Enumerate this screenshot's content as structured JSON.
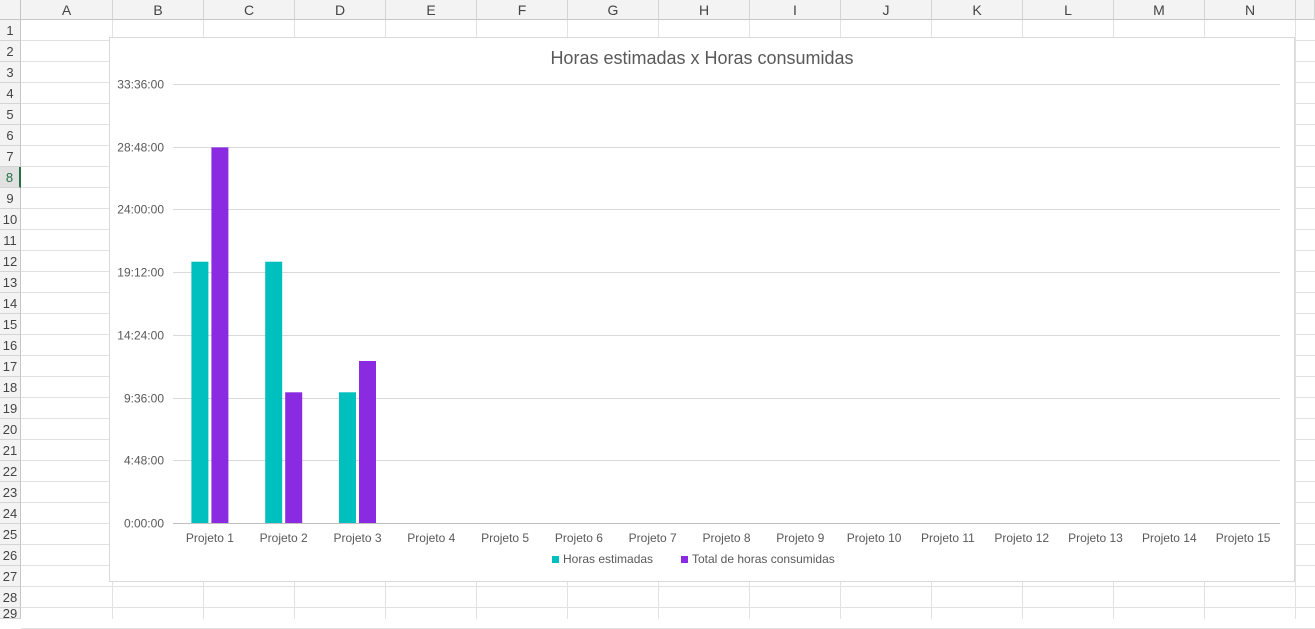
{
  "sheet": {
    "columns": [
      "A",
      "B",
      "C",
      "D",
      "E",
      "F",
      "G",
      "H",
      "I",
      "J",
      "K",
      "L",
      "M",
      "N"
    ],
    "rows": [
      "1",
      "2",
      "3",
      "4",
      "5",
      "6",
      "7",
      "8",
      "9",
      "10",
      "11",
      "12",
      "13",
      "14",
      "15",
      "16",
      "17",
      "18",
      "19",
      "20",
      "21",
      "22",
      "23",
      "24",
      "25",
      "26",
      "27",
      "28",
      "29"
    ],
    "active_row": "8",
    "header_accent": "#217346"
  },
  "chart_data": {
    "type": "bar",
    "title": "Horas estimadas x Horas consumidas",
    "categories": [
      "Projeto 1",
      "Projeto 2",
      "Projeto 3",
      "Projeto 4",
      "Projeto 5",
      "Projeto 6",
      "Projeto 7",
      "Projeto 8",
      "Projeto 9",
      "Projeto 10",
      "Projeto 11",
      "Projeto 12",
      "Projeto 13",
      "Projeto 14",
      "Projeto 15"
    ],
    "series": [
      {
        "name": "Horas estimadas",
        "color": "#00bfbf",
        "values": [
          20,
          20,
          10,
          null,
          null,
          null,
          null,
          null,
          null,
          null,
          null,
          null,
          null,
          null,
          null
        ]
      },
      {
        "name": "Total de horas consumidas",
        "color": "#8a2be2",
        "values": [
          28.75,
          10,
          12.4,
          null,
          null,
          null,
          null,
          null,
          null,
          null,
          null,
          null,
          null,
          null,
          null
        ]
      }
    ],
    "ylim": [
      0,
      33.6
    ],
    "y_ticks": [
      0,
      4.8,
      9.6,
      14.4,
      19.2,
      24,
      28.8,
      33.6
    ],
    "y_tick_labels": [
      "0:00:00",
      "4:48:00",
      "9:36:00",
      "14:24:00",
      "19:12:00",
      "24:00:00",
      "28:48:00",
      "33:36:00"
    ],
    "grid": true,
    "legend_position": "bottom"
  }
}
